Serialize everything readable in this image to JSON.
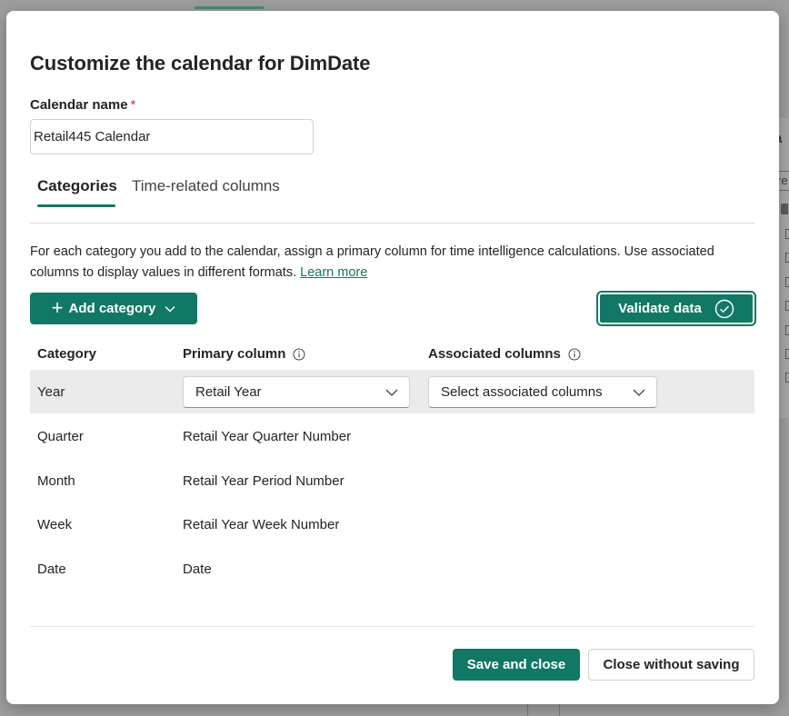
{
  "background": {
    "panel_heading": "a",
    "panel_input_text": "re"
  },
  "dialog": {
    "title": "Customize the calendar for DimDate",
    "calendar_name_label": "Calendar name",
    "required_mark": "*",
    "calendar_name_value": "Retail445 Calendar",
    "tabs": [
      {
        "label": "Categories",
        "selected": true
      },
      {
        "label": "Time-related columns",
        "selected": false
      }
    ],
    "description": "For each category you add to the calendar, assign a primary column for time intelligence calculations. Use associated columns to display values in different formats.",
    "learn_more": "Learn more",
    "add_category_label": "Add category",
    "validate_label": "Validate data",
    "table": {
      "headers": {
        "category": "Category",
        "primary": "Primary column",
        "associated": "Associated columns"
      },
      "rows": [
        {
          "category": "Year",
          "primary": "Retail Year",
          "associated": "Select associated columns"
        },
        {
          "category": "Quarter",
          "primary": "Retail Year Quarter Number"
        },
        {
          "category": "Month",
          "primary": "Retail Year Period Number"
        },
        {
          "category": "Week",
          "primary": "Retail Year Week Number"
        },
        {
          "category": "Date",
          "primary": "Date"
        }
      ]
    },
    "save_label": "Save and close",
    "close_label": "Close without saving"
  },
  "colors": {
    "accent": "#117865",
    "required": "#c4314b",
    "row_highlight": "#ebebeb"
  },
  "icons": [
    "plus-icon",
    "chevron-down-icon",
    "check-circle-icon",
    "info-icon"
  ]
}
